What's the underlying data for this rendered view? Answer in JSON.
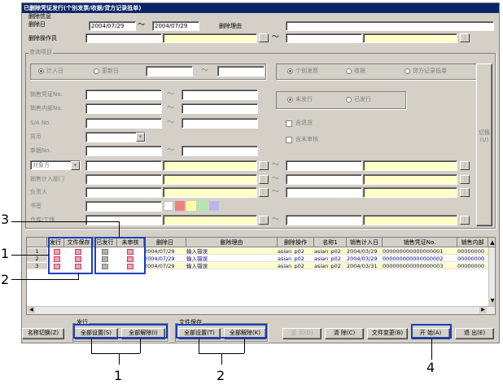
{
  "window": {
    "title": "已删除凭证发行(个别发票/收据/贷方记录抵单)"
  },
  "delete_info": {
    "group_title": "删除信息",
    "delete_date_label": "删除日",
    "date_from": "2004/07/29",
    "date_to": "2004/07/29",
    "tilde": "〜",
    "reason_label": "删除理由",
    "operator_label": "删除操作员"
  },
  "query": {
    "group_title": "查询项目",
    "radio_entry_date": "计入日",
    "radio_update_date": "更新日",
    "radio_invoice": "个别发票",
    "radio_receipt": "收据",
    "radio_credit": "贷方记录抵单",
    "sales_voucher_no": "销售凭证No.",
    "sales_internal_no": "销售内部No.",
    "sa_no": "S/A No.",
    "currency": "货币",
    "slip_no": "单据No.",
    "counterparty": "对象方",
    "sales_dept": "销售计入部门",
    "person_in_charge": "负责人",
    "bookmark": "书签",
    "warehouse": "仓库/工序",
    "radio_unissued": "未发行",
    "radio_issued": "已发行",
    "chk_include_draft": "含退货",
    "chk_include_unreviewed": "含未审核",
    "switch_label": "切换(U)"
  },
  "grid": {
    "headers": [
      "发行",
      "文件保存",
      "已发行",
      "未审核",
      "删除日",
      "删除理由",
      "删除操作",
      "名称1",
      "销售计入日",
      "销售凭证No.",
      "销售内部"
    ],
    "rows": [
      {
        "num": "1",
        "date": "2004/07/29",
        "reason": "输入错误",
        "operator": "asian_p02",
        "name": "asian_p02",
        "entry": "2004/03/29",
        "voucher": "000000000000000001",
        "internal": "00000000"
      },
      {
        "num": "2",
        "date": "2004/07/29",
        "reason": "输入错误",
        "operator": "asian_p02",
        "name": "asian_p02",
        "entry": "2004/03/29",
        "voucher": "000000000000000002",
        "internal": "00000000"
      },
      {
        "num": "3",
        "date": "2004/07/29",
        "reason": "输入错误",
        "operator": "asian_p02",
        "name": "asian_p02",
        "entry": "2004/03/31",
        "voucher": "000000000000000003",
        "internal": "00000000"
      }
    ]
  },
  "bottom": {
    "name_switch": "名称切换(Z)",
    "issue_group": "发行",
    "issue_set_all": "全部设置(S)",
    "issue_clear_all": "全部解除(I)",
    "save_group": "文件保存",
    "save_set_all": "全部设置(T)",
    "save_clear_all": "全部解除(K)",
    "display": "显 示(D)",
    "clear": "清 除(C)",
    "file_change": "文件变更(B)",
    "start": "开 始(A)",
    "exit": "退 出(E)"
  },
  "callouts": {
    "n1": "1",
    "n2": "2",
    "n3": "3",
    "n4": "4"
  },
  "colors": {
    "title_bg": "#0a246a",
    "callout": "#1c3fbf",
    "highlight_yellow": "#ffffc8"
  }
}
